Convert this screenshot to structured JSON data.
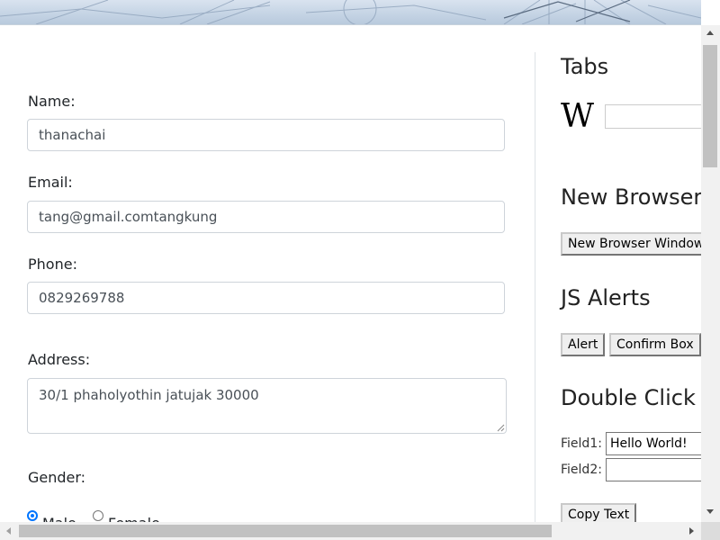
{
  "form": {
    "name_label": "Name:",
    "name_value": "thanachai",
    "email_label": "Email:",
    "email_value": "tang@gmail.comtangkung",
    "phone_label": "Phone:",
    "phone_value": "0829269788",
    "address_label": "Address:",
    "address_value": "30/1 phaholyothin jatujak 30000",
    "gender_label": "Gender:",
    "gender_options": [
      "Male",
      "Female"
    ],
    "gender_selected": "Male"
  },
  "sidebar": {
    "tabs_heading": "Tabs",
    "wiki_logo_text": "W",
    "new_browser_heading": "New Browser Window",
    "new_browser_button": "New Browser Window",
    "js_alerts_heading": "JS Alerts",
    "alert_button": "Alert",
    "confirm_button": "Confirm Box",
    "double_click_heading": "Double Click",
    "field1_label": "Field1:",
    "field1_value": "Hello World!",
    "field2_label": "Field2:",
    "field2_value": "",
    "copy_button": "Copy Text"
  },
  "colors": {
    "accent_radio": "#0075ff",
    "border": "#ced4da"
  }
}
